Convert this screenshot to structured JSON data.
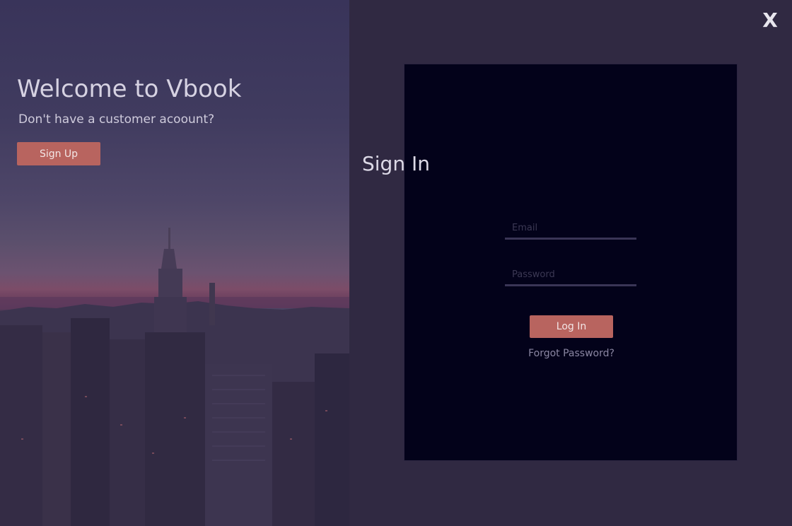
{
  "window": {
    "close_label": "X"
  },
  "hero": {
    "title": "Welcome to Vbook",
    "subtitle": "Don't have a customer acoount?",
    "signup_label": "Sign Up",
    "image": "city-skyline-dusk"
  },
  "signin": {
    "title": "Sign In",
    "email_placeholder": "Email",
    "email_value": "",
    "password_placeholder": "Password",
    "password_value": "",
    "login_label": "Log In",
    "forgot_label": "Forgot Password?"
  },
  "colors": {
    "background": "#302942",
    "card": "#03021a",
    "accent_button": "#b8645f",
    "field_underline": "#3a3556"
  }
}
